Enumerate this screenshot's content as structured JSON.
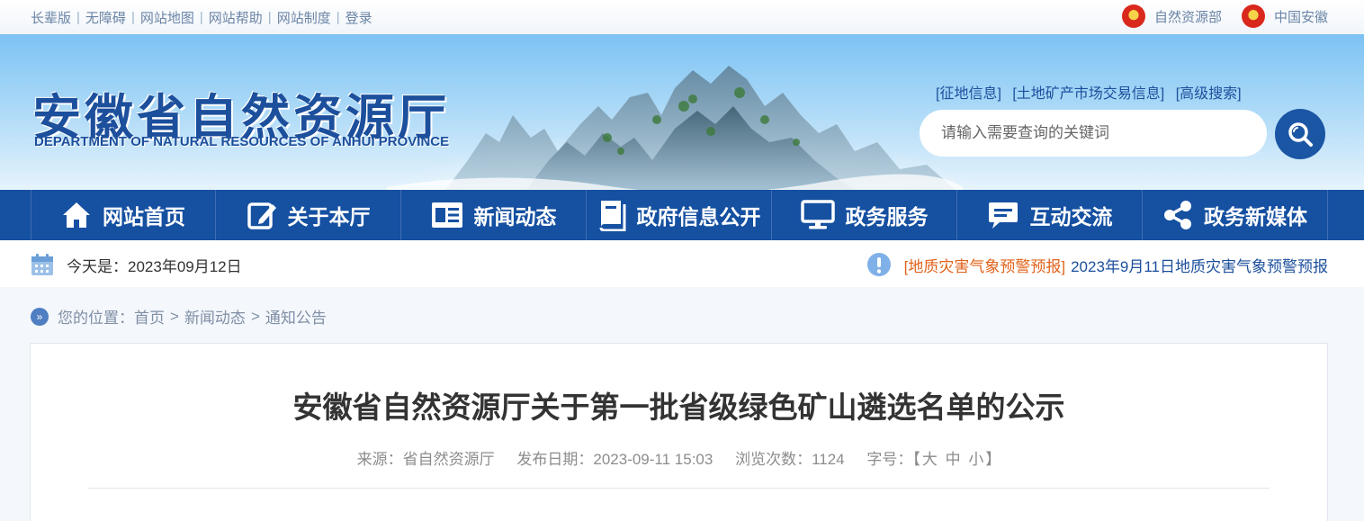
{
  "topbar": {
    "links": [
      "长辈版",
      "无障碍",
      "网站地图",
      "网站帮助",
      "网站制度",
      "登录"
    ],
    "right": [
      "自然资源部",
      "中国安徽"
    ]
  },
  "banner": {
    "title": "安徽省自然资源厅",
    "subtitle": "DEPARTMENT OF NATURAL RESOURCES OF ANHUI PROVINCE",
    "quicklinks": [
      "[征地信息]",
      "[土地矿产市场交易信息]",
      "[高级搜索]"
    ],
    "search_placeholder": "请输入需要查询的关键词"
  },
  "nav": {
    "items": [
      {
        "label": "网站首页",
        "icon": "home-icon"
      },
      {
        "label": "关于本厅",
        "icon": "edit-icon"
      },
      {
        "label": "新闻动态",
        "icon": "news-icon"
      },
      {
        "label": "政府信息公开",
        "icon": "book-icon"
      },
      {
        "label": "政务服务",
        "icon": "monitor-icon"
      },
      {
        "label": "互动交流",
        "icon": "chat-icon"
      },
      {
        "label": "政务新媒体",
        "icon": "share-icon"
      }
    ]
  },
  "datebar": {
    "date": "今天是：2023年09月12日",
    "alert_tag": "[地质灾害气象预警预报]",
    "alert_text": "2023年9月11日地质灾害气象预警预报"
  },
  "breadcrumb": {
    "prefix": "您的位置：",
    "items": [
      "首页",
      "新闻动态",
      "通知公告"
    ]
  },
  "article": {
    "title": "安徽省自然资源厅关于第一批省级绿色矿山遴选名单的公示",
    "source": "来源：省自然资源厅",
    "date": "发布日期：2023-09-11 15:03",
    "views": "浏览次数：1124",
    "fontsize_label": "字号：",
    "fontsize_open": "【",
    "fontsize_options": [
      "大",
      "中",
      "小"
    ],
    "fontsize_close": "】"
  },
  "colors": {
    "nav_bg": "#1550a1",
    "brand_blue": "#1c4f9c",
    "alert_orange": "#e2631b"
  }
}
